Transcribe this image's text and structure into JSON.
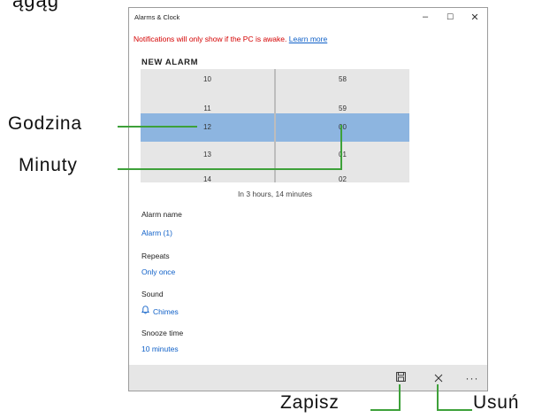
{
  "partial_top_text": "ągąg",
  "window": {
    "title": "Alarms & Clock",
    "controls": {
      "minimize": "–",
      "maximize": "☐",
      "close": "✕"
    }
  },
  "notice": {
    "text": "Notifications will only show if the PC is awake.",
    "link": "Learn more"
  },
  "heading": "NEW ALARM",
  "picker": {
    "hours": [
      "10",
      "11",
      "12",
      "13",
      "14"
    ],
    "minutes": [
      "58",
      "59",
      "00",
      "01",
      "02"
    ],
    "selected_index": 2,
    "hint": "In 3 hours, 14 minutes"
  },
  "fields": {
    "alarm_name": {
      "label": "Alarm name",
      "value": "Alarm (1)"
    },
    "repeats": {
      "label": "Repeats",
      "value": "Only once"
    },
    "sound": {
      "label": "Sound",
      "value": "Chimes",
      "icon": "bell-icon"
    },
    "snooze": {
      "label": "Snooze time",
      "value": "10 minutes"
    }
  },
  "command_bar": {
    "save_icon": "save-icon",
    "delete_icon": "close-icon",
    "more_glyph": "···"
  },
  "callouts": {
    "hour": "Godzina",
    "minute": "Minuty",
    "save": "Zapisz",
    "delete": "Usuń"
  },
  "colors": {
    "callout_line": "#3ea13a",
    "selection": "#8db5e0",
    "accent": "#0f60c8",
    "warning": "#d40000"
  }
}
